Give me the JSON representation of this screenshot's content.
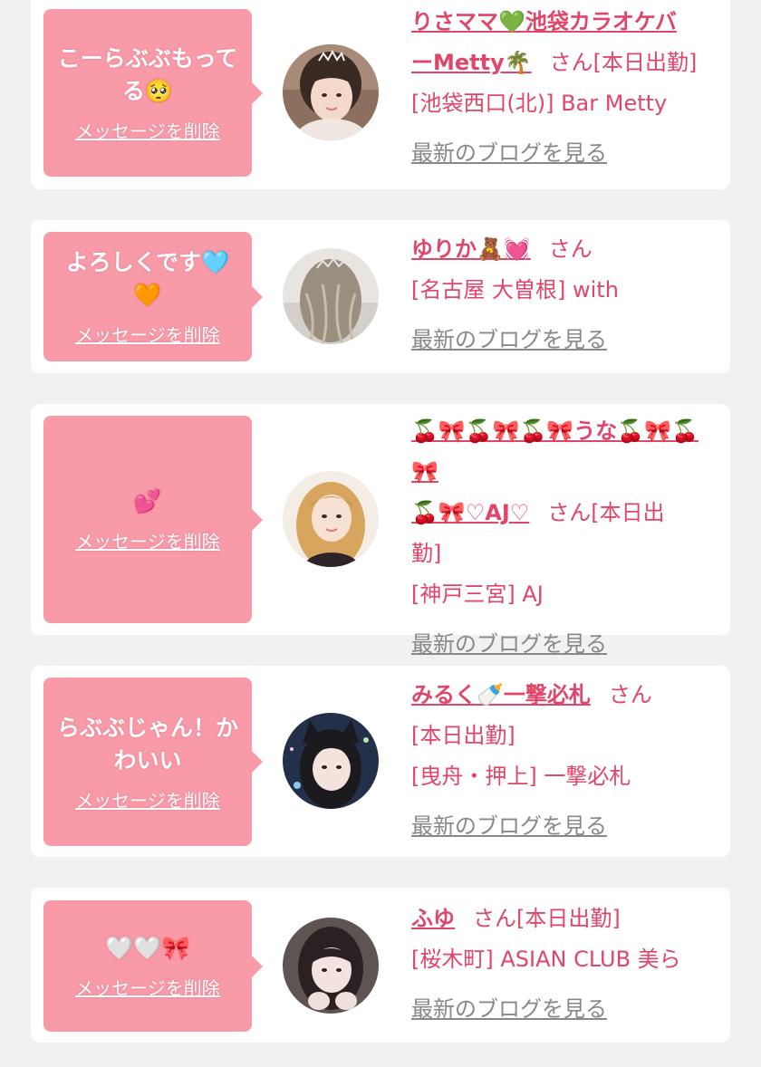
{
  "colors": {
    "page_background": "#f1f1f1",
    "card_background": "#ffffff",
    "bubble": "#f99aa9",
    "accent_text": "#e0466a",
    "muted_link": "#888888"
  },
  "messages": [
    {
      "bubble_line1": "こーらぶぶもって",
      "bubble_line2": "る🥺",
      "delete_label": "メッセージを削除",
      "name_line1": "りさママ💚池袋カラオケバ",
      "name_line2": "ーMetty🌴",
      "suffix_line2": "さん[本日出勤]",
      "shop": "[池袋西口(北)] Bar Metty",
      "blog_label": "最新のブログを見る",
      "avatar_icon": "avatar-woman-tiara"
    },
    {
      "bubble_line1": "よろしくです🩵",
      "bubble_line2": "🧡",
      "delete_label": "メッセージを削除",
      "name": "ゆりか🧸💓",
      "suffix": "さん",
      "shop": "[名古屋 大曽根] with",
      "blog_label": "最新のブログを見る",
      "avatar_icon": "avatar-back-of-head"
    },
    {
      "bubble_line1": "💕",
      "delete_label": "メッセージを削除",
      "name_line1": "🍒🎀🍒🎀🍒🎀うな🍒🎀🍒🎀",
      "name_line2": "🍒🎀♡AJ♡",
      "suffix_line2": "さん[本日出",
      "suffix_line3": "勤]",
      "shop": "[神戸三宮] AJ",
      "blog_label": "最新のブログを見る",
      "avatar_icon": "avatar-blonde-woman"
    },
    {
      "bubble_line1": "らぶぶじゃん！か",
      "bubble_line2": "わいい",
      "delete_label": "メッセージを削除",
      "name": "みるく🍼一撃必札",
      "suffix": "さん",
      "status": "[本日出勤]",
      "shop": "[曳舟・押上] 一撃必札",
      "blog_label": "最新のブログを見る",
      "avatar_icon": "avatar-cat-ears"
    },
    {
      "bubble_line1": "🤍🤍🎀",
      "delete_label": "メッセージを削除",
      "name": "ふゆ",
      "suffix": "さん[本日出勤]",
      "shop": "[桜木町] ASIAN CLUB 美ら",
      "blog_label": "最新のブログを見る",
      "avatar_icon": "avatar-dark-hair-woman"
    }
  ]
}
